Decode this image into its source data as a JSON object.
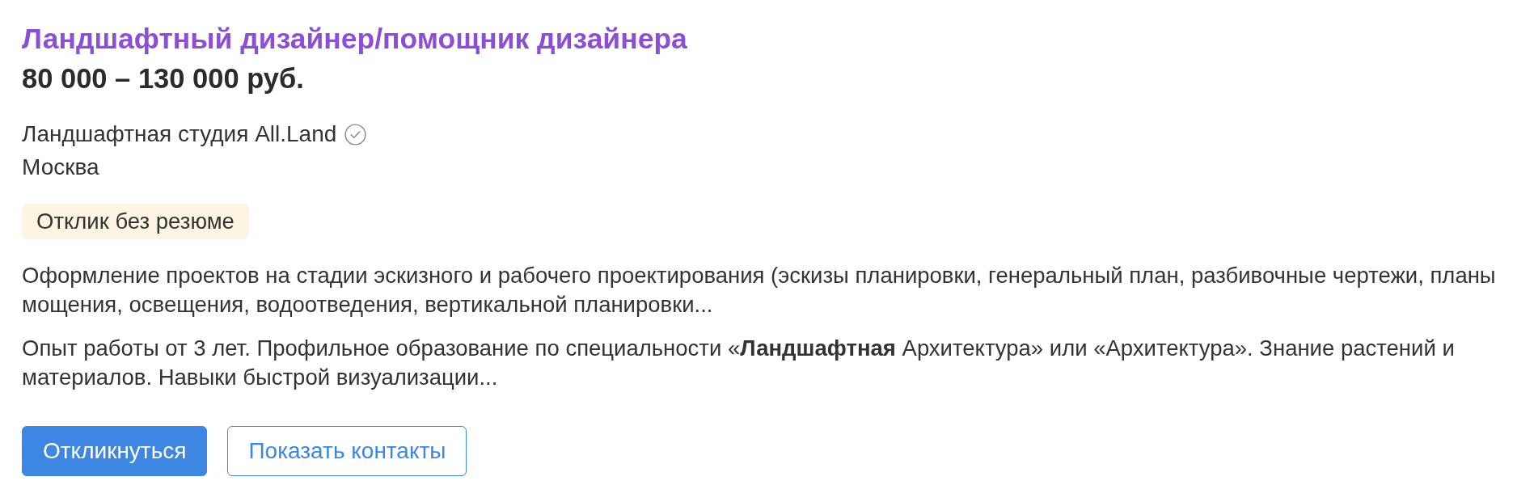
{
  "vacancy": {
    "title": "Ландшафтный дизайнер/помощник дизайнера",
    "salary": "80 000 – 130 000 руб.",
    "company": {
      "name": "Ландшафтная студия All.Land",
      "verified": true
    },
    "location": "Москва",
    "badges": [
      "Отклик без резюме"
    ],
    "snippets": [
      "Оформление проектов на стадии эскизного и рабочего проектирования (эскизы планировки, генеральный план, разбивочные чертежи, планы мощения, освещения, водоотведения, вертикальной планировки...",
      "Опыт работы от 3 лет. Профильное образование по специальности «**Ландшафтная** Архитектура» или «Архитектура». Знание растений и материалов. Навыки быстрой визуализации..."
    ],
    "buttons": [
      {
        "kind": "primary",
        "label": "Откликнуться"
      },
      {
        "kind": "secondary",
        "label": "Показать контакты"
      }
    ]
  }
}
